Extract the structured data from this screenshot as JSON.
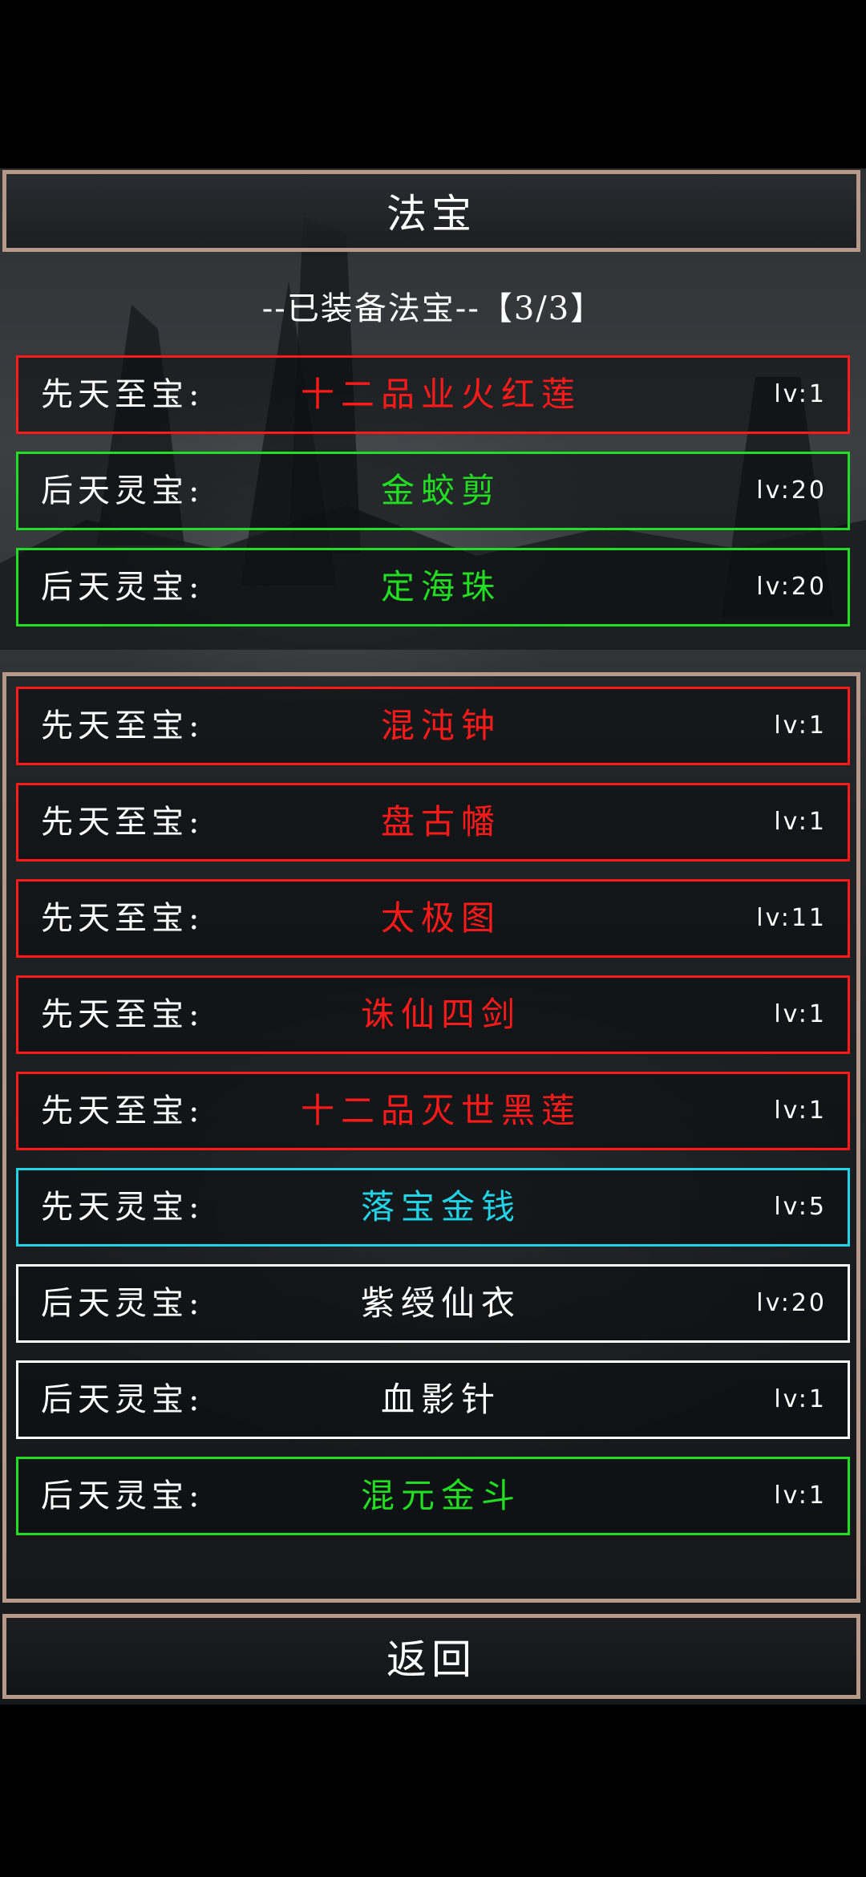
{
  "header": {
    "title": "法宝"
  },
  "equipped": {
    "caption": "--已装备法宝--【3/3】",
    "items": [
      {
        "category": "先天至宝:",
        "name": "十二品业火红莲",
        "level": "lv:1",
        "color": "#ff1a1a"
      },
      {
        "category": "后天灵宝:",
        "name": "金蛟剪",
        "level": "lv:20",
        "color": "#22dd22"
      },
      {
        "category": "后天灵宝:",
        "name": "定海珠",
        "level": "lv:20",
        "color": "#22dd22"
      }
    ]
  },
  "inventory": {
    "items": [
      {
        "category": "先天至宝:",
        "name": "混沌钟",
        "level": "lv:1",
        "color": "#ff1a1a"
      },
      {
        "category": "先天至宝:",
        "name": "盘古幡",
        "level": "lv:1",
        "color": "#ff1a1a"
      },
      {
        "category": "先天至宝:",
        "name": "太极图",
        "level": "lv:11",
        "color": "#ff1a1a"
      },
      {
        "category": "先天至宝:",
        "name": "诛仙四剑",
        "level": "lv:1",
        "color": "#ff1a1a"
      },
      {
        "category": "先天至宝:",
        "name": "十二品灭世黑莲",
        "level": "lv:1",
        "color": "#ff1a1a"
      },
      {
        "category": "先天灵宝:",
        "name": "落宝金钱",
        "level": "lv:5",
        "color": "#22d3e6"
      },
      {
        "category": "后天灵宝:",
        "name": "紫绶仙衣",
        "level": "lv:20",
        "color": "#ffffff"
      },
      {
        "category": "后天灵宝:",
        "name": "血影针",
        "level": "lv:1",
        "color": "#ffffff"
      },
      {
        "category": "后天灵宝:",
        "name": "混元金斗",
        "level": "lv:1",
        "color": "#22dd22"
      }
    ]
  },
  "footer": {
    "back_label": "返回"
  },
  "colors": {
    "frame": "#b7998a",
    "background": "#000000"
  }
}
